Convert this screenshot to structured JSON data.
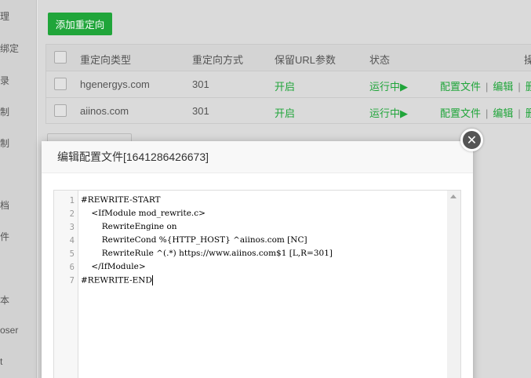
{
  "sidebar": {
    "items": [
      "理",
      "绑定",
      "录",
      "制",
      "制",
      "档",
      "件",
      "本",
      "oser",
      "t"
    ]
  },
  "toolbar": {
    "add_redirect_label": "添加重定向"
  },
  "table": {
    "headers": [
      "重定向类型",
      "重定向方式",
      "保留URL参数",
      "状态",
      "操"
    ],
    "rows": [
      {
        "domain": "hgenergys.com",
        "method": "301",
        "keep_params": "开启",
        "status": "运行中▶",
        "config": "配置文件",
        "edit": "编辑",
        "delete": "删"
      },
      {
        "domain": "aiinos.com",
        "method": "301",
        "keep_params": "开启",
        "status": "运行中▶",
        "config": "配置文件",
        "edit": "编辑",
        "delete": "删"
      }
    ],
    "separator": "|"
  },
  "modal": {
    "title": "编辑配置文件[1641286426673]",
    "close_symbol": "✕",
    "editor": {
      "line_numbers": [
        "1",
        "2",
        "3",
        "4",
        "5",
        "6",
        "7"
      ],
      "lines": [
        "#REWRITE-START",
        "    <IfModule mod_rewrite.c>",
        "        RewriteEngine on",
        "        RewriteCond %{HTTP_HOST} ^aiinos.com [NC]",
        "        RewriteRule ^(.*) https://www.aiinos.com$1 [L,R=301]",
        "    </IfModule>",
        "#REWRITE-END"
      ]
    }
  },
  "colors": {
    "accent": "#20a53a",
    "overlay": "#dadada"
  },
  "icons": {
    "close": "close-icon",
    "scroll_up": "scroll-up-arrow-icon"
  }
}
